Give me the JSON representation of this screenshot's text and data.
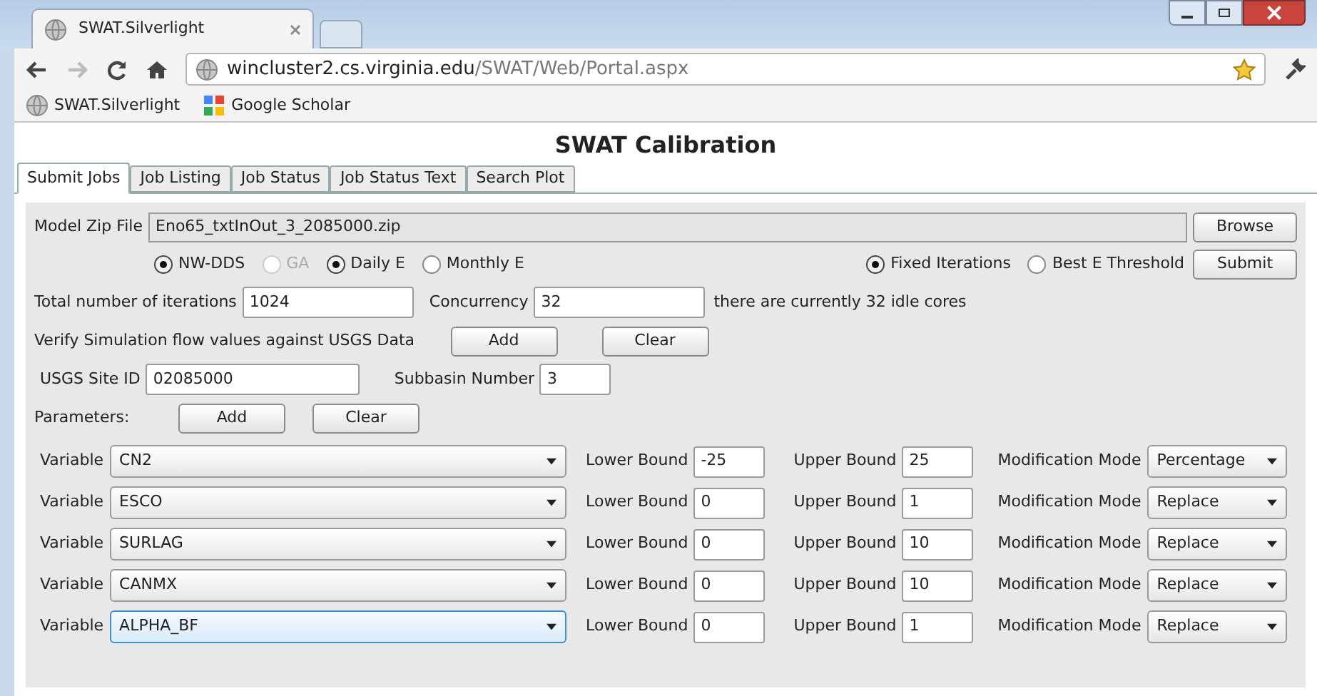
{
  "browser": {
    "tab_title": "SWAT.Silverlight",
    "url_host": "wincluster2.cs.virginia.edu",
    "url_path": "/SWAT/Web/Portal.aspx",
    "bookmarks": [
      "SWAT.Silverlight",
      "Google Scholar"
    ]
  },
  "page_title": "SWAT Calibration",
  "tabs": [
    {
      "label": "Submit Jobs",
      "selected": true
    },
    {
      "label": "Job Listing",
      "selected": false
    },
    {
      "label": "Job Status",
      "selected": false
    },
    {
      "label": "Job Status Text",
      "selected": false
    },
    {
      "label": "Search Plot",
      "selected": false
    }
  ],
  "model_zip": {
    "label": "Model Zip File",
    "value": "Eno65_txtInOut_3_2085000.zip",
    "browse": "Browse"
  },
  "radios_left": [
    {
      "label": "NW-DDS",
      "selected": true,
      "disabled": false
    },
    {
      "label": "GA",
      "selected": false,
      "disabled": true
    },
    {
      "label": "Daily E",
      "selected": true,
      "disabled": false
    },
    {
      "label": "Monthly E",
      "selected": false,
      "disabled": false
    }
  ],
  "radios_right": [
    {
      "label": "Fixed Iterations",
      "selected": true,
      "disabled": false
    },
    {
      "label": "Best E Threshold",
      "selected": false,
      "disabled": false
    }
  ],
  "submit": "Submit",
  "iterations": {
    "label": "Total number of iterations",
    "value": "1024"
  },
  "concurrency": {
    "label": "Concurrency",
    "value": "32",
    "note": "there are currently 32 idle cores"
  },
  "verify": {
    "label": "Verify Simulation flow values against USGS Data",
    "add": "Add",
    "clear": "Clear"
  },
  "site": {
    "label": "USGS Site ID",
    "value": "02085000",
    "subbasin_label": "Subbasin Number",
    "subbasin_value": "3"
  },
  "parameters": {
    "label": "Parameters:",
    "add": "Add",
    "clear": "Clear"
  },
  "variables": [
    {
      "label": "Variable",
      "value": "CN2",
      "focused": false,
      "lower_label": "Lower Bound",
      "lower": "-25",
      "upper_label": "Upper Bound",
      "upper": "25",
      "mode_label": "Modification Mode",
      "mode": "Percentage"
    },
    {
      "label": "Variable",
      "value": "ESCO",
      "focused": false,
      "lower_label": "Lower Bound",
      "lower": "0",
      "upper_label": "Upper Bound",
      "upper": "1",
      "mode_label": "Modification Mode",
      "mode": "Replace"
    },
    {
      "label": "Variable",
      "value": "SURLAG",
      "focused": false,
      "lower_label": "Lower Bound",
      "lower": "0",
      "upper_label": "Upper Bound",
      "upper": "10",
      "mode_label": "Modification Mode",
      "mode": "Replace"
    },
    {
      "label": "Variable",
      "value": "CANMX",
      "focused": false,
      "lower_label": "Lower Bound",
      "lower": "0",
      "upper_label": "Upper Bound",
      "upper": "10",
      "mode_label": "Modification Mode",
      "mode": "Replace"
    },
    {
      "label": "Variable",
      "value": "ALPHA_BF",
      "focused": true,
      "lower_label": "Lower Bound",
      "lower": "0",
      "upper_label": "Upper Bound",
      "upper": "1",
      "mode_label": "Modification Mode",
      "mode": "Replace"
    }
  ]
}
